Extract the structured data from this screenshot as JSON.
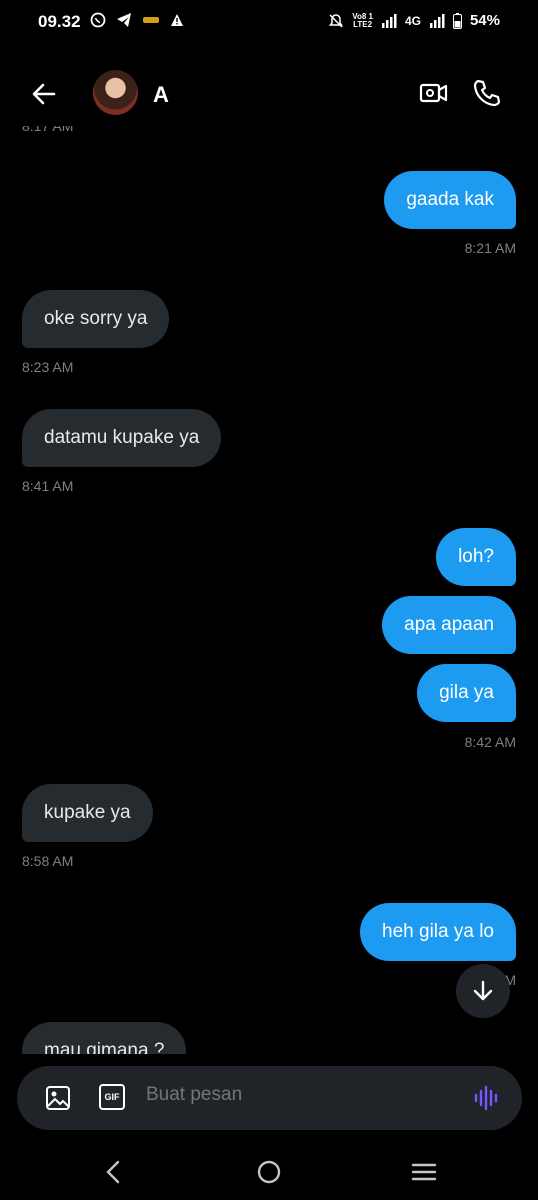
{
  "status_bar": {
    "time": "09.32",
    "network_top": "Vo8 1",
    "network_bottom": "LTE2",
    "signal_type": "4G",
    "battery": "54%"
  },
  "header": {
    "contact_name": "A"
  },
  "messages": [
    {
      "kind": "timestamp",
      "text": "8:17 AM"
    },
    {
      "kind": "sent",
      "text": "gaada kak",
      "time": "8:21 AM"
    },
    {
      "kind": "received",
      "text": "oke sorry ya",
      "time": "8:23 AM"
    },
    {
      "kind": "received",
      "text": "datamu kupake ya",
      "time": "8:41 AM"
    },
    {
      "kind": "sent",
      "text": "loh?"
    },
    {
      "kind": "sent",
      "text": "apa apaan"
    },
    {
      "kind": "sent",
      "text": "gila ya",
      "time": "8:42 AM"
    },
    {
      "kind": "received",
      "text": "kupake ya",
      "time": "8:58 AM"
    },
    {
      "kind": "sent",
      "text": "heh gila ya lo",
      "time": "9:01 AM"
    },
    {
      "kind": "received",
      "text": "mau gimana ?"
    }
  ],
  "composer": {
    "placeholder": "Buat pesan",
    "gif_label": "GIF"
  },
  "colors": {
    "sent_bubble": "#1d9bf0",
    "received_bubble": "#262b30",
    "voice_icon": "#7856ff"
  }
}
